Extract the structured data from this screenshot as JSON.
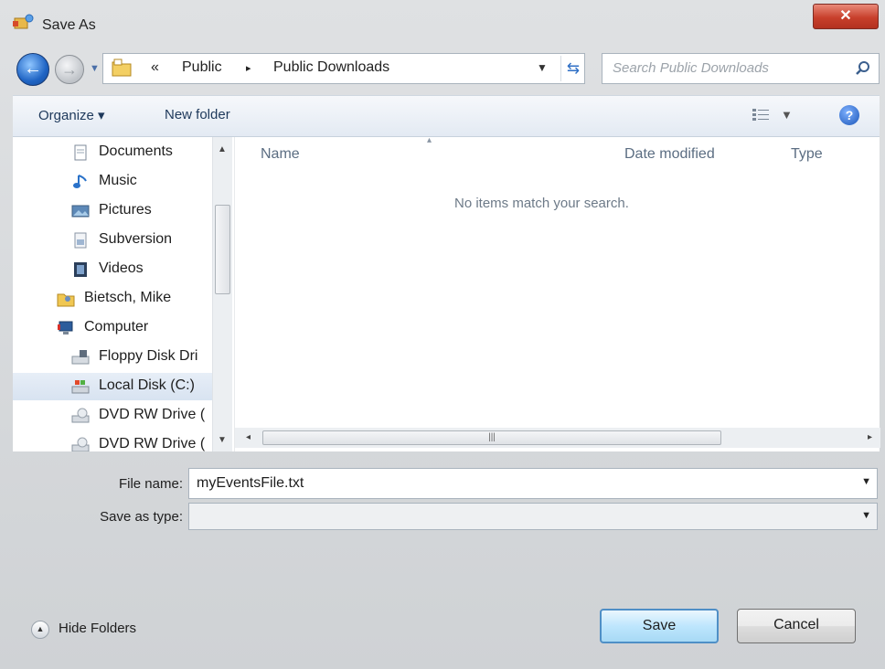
{
  "window": {
    "title": "Save As",
    "close_symbol": "✕"
  },
  "address": {
    "overflow": "«",
    "separator": "▸",
    "crumbs": [
      "Public",
      "Public Downloads"
    ]
  },
  "search": {
    "placeholder": "Search Public Downloads"
  },
  "toolbar": {
    "organize_label": "Organize ▾",
    "new_folder_label": "New folder"
  },
  "nav": {
    "items": [
      {
        "label": "Documents",
        "icon": "documents-icon"
      },
      {
        "label": "Music",
        "icon": "music-icon"
      },
      {
        "label": "Pictures",
        "icon": "pictures-icon"
      },
      {
        "label": "Subversion",
        "icon": "subversion-icon"
      },
      {
        "label": "Videos",
        "icon": "videos-icon"
      },
      {
        "label": "Bietsch, Mike",
        "icon": "user-folder-icon"
      },
      {
        "label": "Computer",
        "icon": "computer-icon"
      },
      {
        "label": "Floppy Disk Dri",
        "icon": "floppy-icon"
      },
      {
        "label": "Local Disk (C:)",
        "icon": "local-disk-icon",
        "selected": true
      },
      {
        "label": "DVD RW Drive (",
        "icon": "dvd-drive-icon"
      },
      {
        "label": "DVD RW Drive (",
        "icon": "dvd-drive-icon"
      }
    ]
  },
  "list": {
    "columns": [
      "Name",
      "Date modified",
      "Type"
    ],
    "empty_message": "No items match your search."
  },
  "form": {
    "file_name_label": "File name:",
    "file_name_value": "myEventsFile.txt",
    "save_as_type_label": "Save as type:",
    "save_as_type_value": ""
  },
  "footer": {
    "hide_folders_label": "Hide Folders",
    "save_label": "Save",
    "cancel_label": "Cancel"
  }
}
